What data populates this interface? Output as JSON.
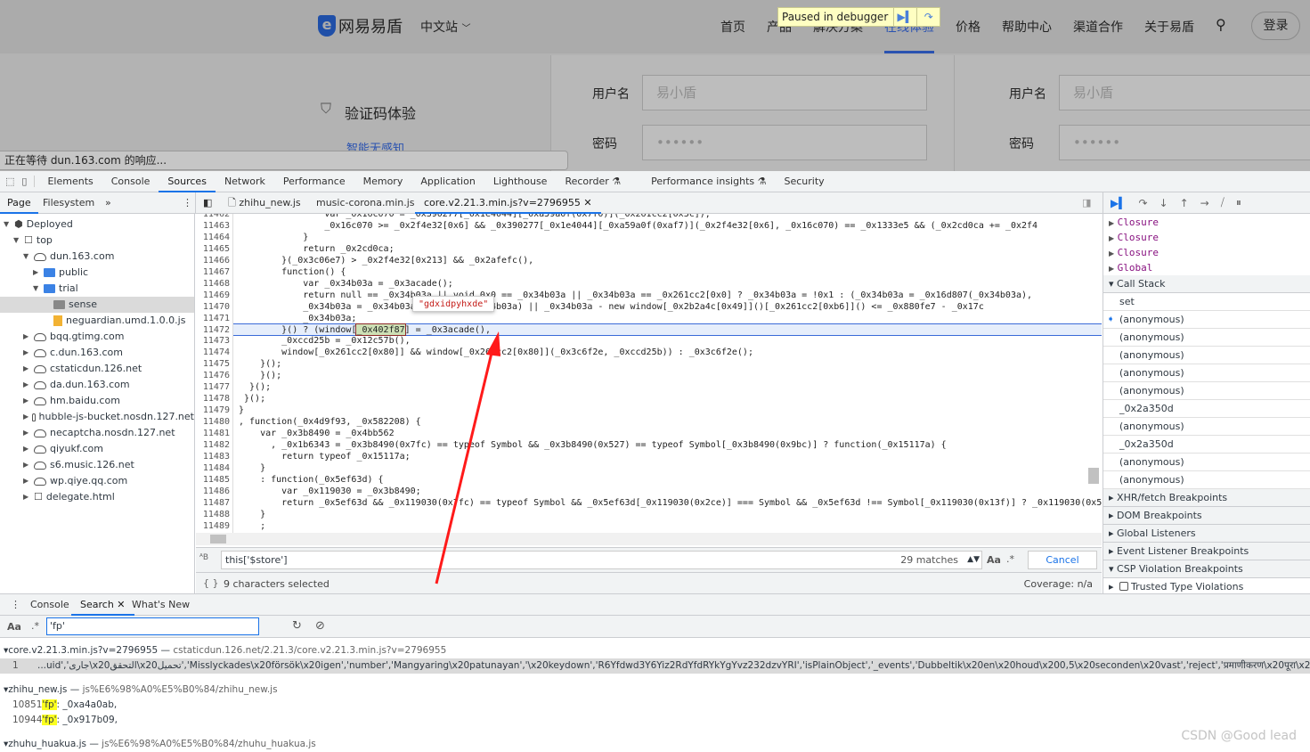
{
  "site": {
    "brand": "网易易盾",
    "locale": "中文站",
    "nav": [
      "首页",
      "产品",
      "解决方案",
      "在线体验",
      "价格",
      "帮助中心",
      "渠道合作",
      "关于易盾"
    ],
    "active_nav": "在线体验",
    "login": "登录",
    "section_title": "验证码体验",
    "section_link": "智能无感知",
    "form": [
      {
        "label": "用户名",
        "placeholder": "易小盾"
      },
      {
        "label": "密码",
        "placeholder": "••••••"
      }
    ],
    "paused": "Paused in debugger",
    "waiting": "正在等待 dun.163.com 的响应..."
  },
  "devtools": {
    "tabs": [
      "Elements",
      "Console",
      "Sources",
      "Network",
      "Performance",
      "Memory",
      "Application",
      "Lighthouse",
      "Recorder ⚗",
      "Performance insights ⚗",
      "Security"
    ],
    "active_tab": "Sources",
    "nav_tabs": [
      "Page",
      "Filesystem"
    ],
    "file_tabs": [
      "zhihu_new.js",
      "music-corona.min.js",
      "core.v2.21.3.min.js?v=2796955"
    ],
    "tree": [
      {
        "label": "Deployed",
        "depth": 0,
        "icon": "box",
        "open": true
      },
      {
        "label": "top",
        "depth": 1,
        "icon": "frame",
        "open": true
      },
      {
        "label": "dun.163.com",
        "depth": 2,
        "icon": "cloud",
        "open": true
      },
      {
        "label": "public",
        "depth": 3,
        "icon": "folder",
        "open": false
      },
      {
        "label": "trial",
        "depth": 3,
        "icon": "folder",
        "open": true
      },
      {
        "label": "sense",
        "depth": 4,
        "icon": "folder-gray",
        "selected": true
      },
      {
        "label": "neguardian.umd.1.0.0.js",
        "depth": 4,
        "icon": "file"
      },
      {
        "label": "bqq.gtimg.com",
        "depth": 2,
        "icon": "cloud"
      },
      {
        "label": "c.dun.163.com",
        "depth": 2,
        "icon": "cloud"
      },
      {
        "label": "cstaticdun.126.net",
        "depth": 2,
        "icon": "cloud"
      },
      {
        "label": "da.dun.163.com",
        "depth": 2,
        "icon": "cloud"
      },
      {
        "label": "hm.baidu.com",
        "depth": 2,
        "icon": "cloud"
      },
      {
        "label": "hubble-js-bucket.nosdn.127.net",
        "depth": 2,
        "icon": "cloud"
      },
      {
        "label": "necaptcha.nosdn.127.net",
        "depth": 2,
        "icon": "cloud"
      },
      {
        "label": "qiyukf.com",
        "depth": 2,
        "icon": "cloud"
      },
      {
        "label": "s6.music.126.net",
        "depth": 2,
        "icon": "cloud"
      },
      {
        "label": "wp.qiye.qq.com",
        "depth": 2,
        "icon": "cloud"
      },
      {
        "label": "delegate.html",
        "depth": 2,
        "icon": "frame"
      }
    ],
    "code": [
      {
        "n": "11462",
        "t": "                var _0x16c070 = _0x390277[_0x1e4044][_0xa59a0f(0x7f0)](_0x261cc2[0x3c]);"
      },
      {
        "n": "11463",
        "t": "                _0x16c070 >= _0x2f4e32[0x6] && _0x390277[_0x1e4044][_0xa59a0f(0xaf7)](_0x2f4e32[0x6], _0x16c070) == _0x1333e5 && (_0x2cd0ca += _0x2f4"
      },
      {
        "n": "11464",
        "t": "            }"
      },
      {
        "n": "11465",
        "t": "            return _0x2cd0ca;"
      },
      {
        "n": "11466",
        "t": "        }(_0x3c06e7) > _0x2f4e32[0x213] && _0x2afefc(),"
      },
      {
        "n": "11467",
        "t": "        function() {"
      },
      {
        "n": "11468",
        "t": "            var _0x34b03a = _0x3acade();"
      },
      {
        "n": "11469",
        "t": "            return null == _0x34b03a || void 0x0 == _0x34b03a || _0x34b03a == _0x261cc2[0x0] ? _0x34b03a = !0x1 : (_0x34b03a = _0x16d807(_0x34b03a),"
      },
      {
        "n": "11470",
        "t": "            _0x34b03a = _0x34b03a || isNaN(_0x34b03a) || _0x34b03a - new window[_0x2b2a4c[0x49]]()[_0x261cc2[0xb6]]() <= _0x880fe7 - _0x17c"
      },
      {
        "n": "11471",
        "t": "            _0x34b03a;"
      },
      {
        "n": "11472",
        "t": "        }() ? (window[_0x402f87] = _0x3acade(),"
      },
      {
        "n": "11473",
        "t": "        _0xccd25b = _0x12c57b(),"
      },
      {
        "n": "11474",
        "t": "        window[_0x261cc2[0x80]] && window[_0x261cc2[0x80]](_0x3c6f2e, _0xccd25b)) : _0x3c6f2e();"
      },
      {
        "n": "11475",
        "t": "    }();"
      },
      {
        "n": "11476",
        "t": "    }();"
      },
      {
        "n": "11477",
        "t": "  }();"
      },
      {
        "n": "11478",
        "t": " }();"
      },
      {
        "n": "11479",
        "t": "}"
      },
      {
        "n": "11480",
        "t": ", function(_0x4d9f93, _0x582208) {"
      },
      {
        "n": "11481",
        "t": "    var _0x3b8490 = _0x4bb562"
      },
      {
        "n": "11482",
        "t": "      , _0x1b6343 = _0x3b8490(0x7fc) == typeof Symbol && _0x3b8490(0x527) == typeof Symbol[_0x3b8490(0x9bc)] ? function(_0x15117a) {"
      },
      {
        "n": "11483",
        "t": "        return typeof _0x15117a;"
      },
      {
        "n": "11484",
        "t": "    }"
      },
      {
        "n": "11485",
        "t": "    : function(_0x5ef63d) {"
      },
      {
        "n": "11486",
        "t": "        var _0x119030 = _0x3b8490;"
      },
      {
        "n": "11487",
        "t": "        return _0x5ef63d && _0x119030(0x7fc) == typeof Symbol && _0x5ef63d[_0x119030(0x2ce)] === Symbol && _0x5ef63d !== Symbol[_0x119030(0x13f)] ? _0x119030(0x5"
      },
      {
        "n": "11488",
        "t": "    }"
      },
      {
        "n": "11489",
        "t": "    ;"
      }
    ],
    "paused_line": "11472",
    "selected_token": "_0x402f87",
    "hover_value": "\"gdxidpyhxde\"",
    "find": {
      "query": "this['$store']",
      "matches": "29 matches",
      "case": "Aa",
      "regex": ".*",
      "cancel": "Cancel"
    },
    "status": {
      "selection": "9 characters selected",
      "coverage": "Coverage: n/a"
    },
    "scope": [
      "Closure",
      "Closure",
      "Closure",
      "Global"
    ],
    "call_stack_title": "Call Stack",
    "call_stack": [
      "set",
      "(anonymous)",
      "(anonymous)",
      "(anonymous)",
      "(anonymous)",
      "(anonymous)",
      "_0x2a350d",
      "(anonymous)",
      "_0x2a350d",
      "(anonymous)",
      "(anonymous)"
    ],
    "current_frame": 1,
    "sections": [
      "XHR/fetch Breakpoints",
      "DOM Breakpoints",
      "Global Listeners",
      "Event Listener Breakpoints",
      "CSP Violation Breakpoints"
    ],
    "trusted": "Trusted Type Violations",
    "drawer_tabs": [
      "Console",
      "Search",
      "What's New"
    ],
    "search_query": "'fp'",
    "results": [
      {
        "file": "core.v2.21.3.min.js?v=2796955",
        "url": "cstaticdun.126.net/2.21.3/core.v2.21.3.min.js?v=2796955",
        "lines": [
          {
            "n": "1",
            "pre": "...uid','جارى\\x20التحقق\\x20تحميل','Misslyckades\\x20försök\\x20igen','number','Mangyaring\\x20patunayan','\\x20keydown','R6Yfdwd3Y6Yiz2RdYfdRYkYgYvz232dzvYRI','isPlainObject','_events','Dubbeltik\\x20en\\x20houd\\x200,5\\x20seconden\\x20vast','reject','प्रमाणीकरण\\x20पूरा\\x20नहीं\\x20किया\\x20गया\\x20है','Quá",
            "hit": "",
            "post": ""
          }
        ]
      },
      {
        "file": "zhihu_new.js",
        "url": "js%E6%98%A0%E5%B0%84/zhihu_new.js",
        "lines": [
          {
            "n": "10851",
            "pre": "",
            "hit": "'fp'",
            "post": ": _0xa4a0ab,"
          },
          {
            "n": "10944",
            "pre": "",
            "hit": "'fp'",
            "post": ": _0x917b09,"
          }
        ]
      },
      {
        "file": "zhuhu_huakua.js",
        "url": "js%E6%98%A0%E5%B0%84/zhuhu_huakua.js",
        "lines": []
      }
    ]
  },
  "watermark": "CSDN @Good lead",
  "colors": {
    "accent": "#1a73e8",
    "arrow": "#ff1a1a",
    "brand": "#2a52b0"
  }
}
